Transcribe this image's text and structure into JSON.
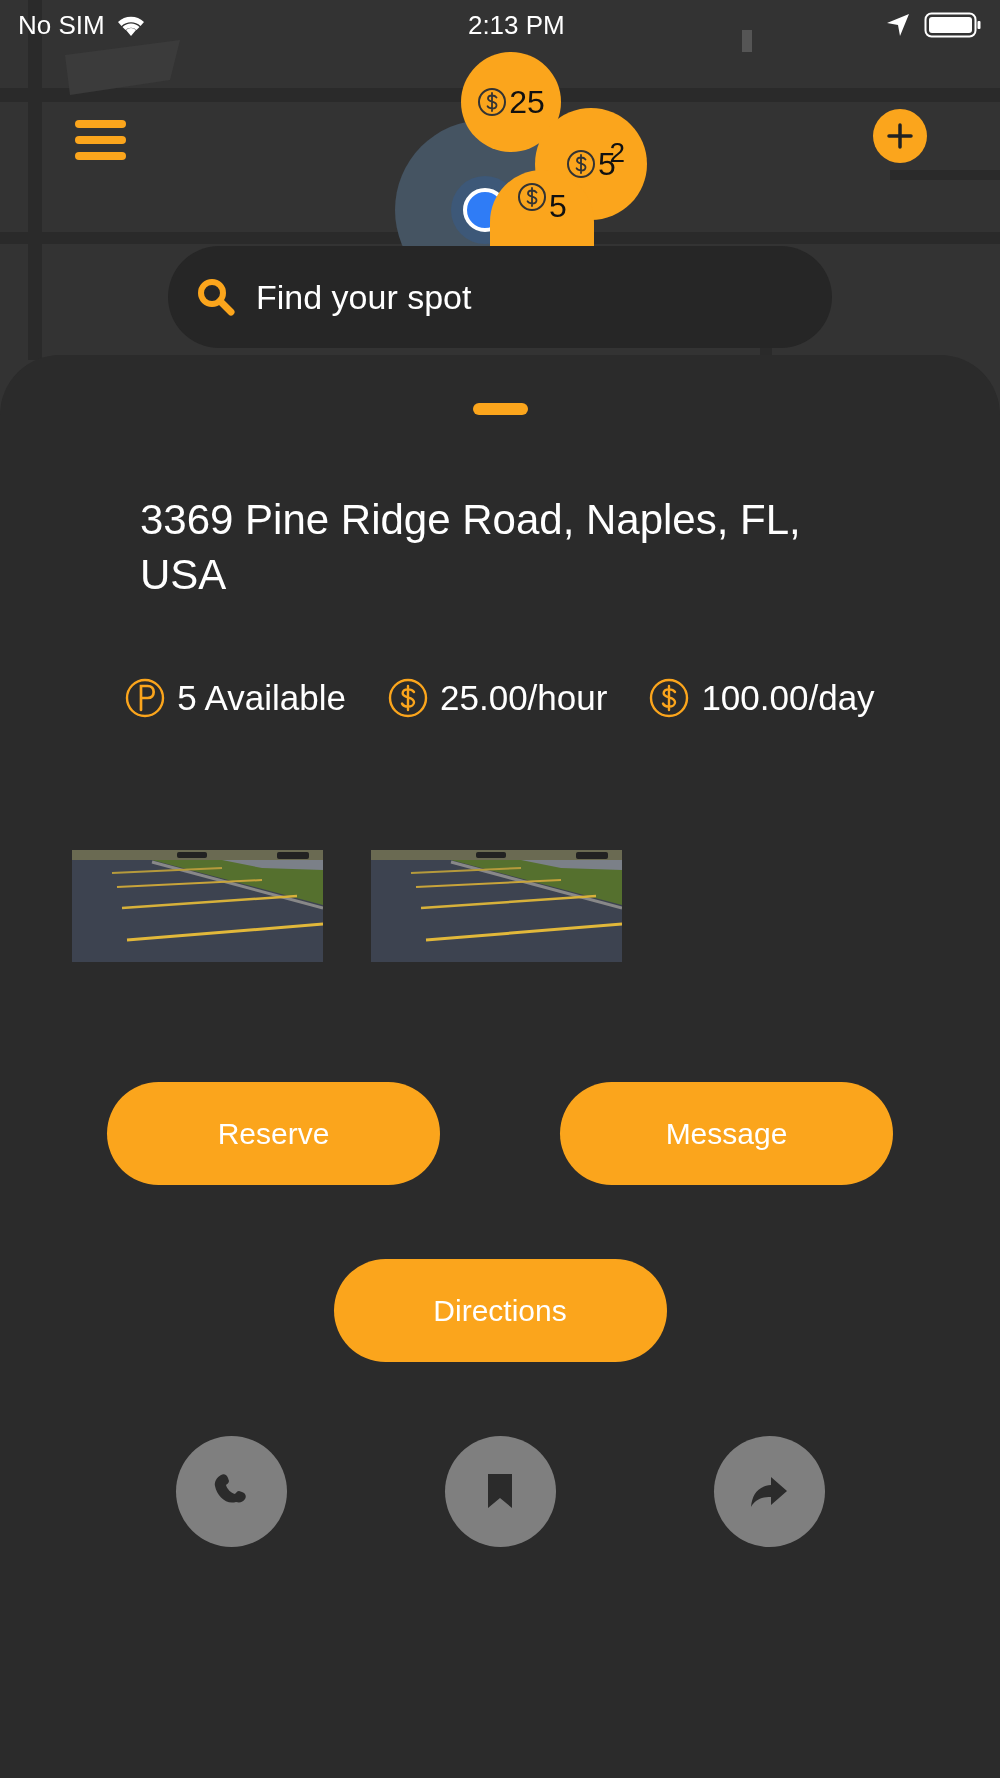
{
  "status_bar": {
    "carrier": "No SIM",
    "time": "2:13 PM"
  },
  "map": {
    "kind": "picture",
    "pins": [
      {
        "price": "25"
      },
      {
        "price": "5",
        "count": "2"
      },
      {
        "price": "5"
      }
    ]
  },
  "search": {
    "placeholder": "Find your spot"
  },
  "spot": {
    "address": "3369 Pine Ridge Road, Naples, FL, USA",
    "facts": [
      {
        "kind": "parking",
        "text": "5 Available"
      },
      {
        "kind": "price",
        "text": "25.00/hour"
      },
      {
        "kind": "price",
        "text": "100.00/day"
      }
    ],
    "buttons": [
      "Reserve",
      "Message",
      "Directions"
    ],
    "actions": [
      {
        "kind": "phone"
      },
      {
        "kind": "bookmark"
      },
      {
        "kind": "share"
      }
    ]
  }
}
